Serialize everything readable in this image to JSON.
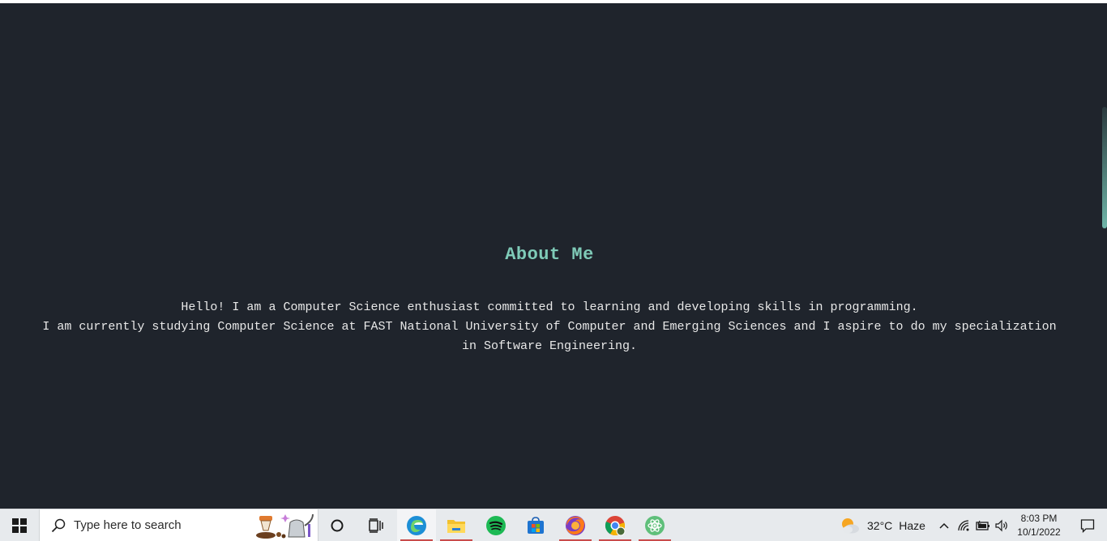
{
  "about": {
    "title": "About Me",
    "line1": "Hello! I am a Computer Science enthusiast committed to learning and developing skills in programming.",
    "line2": "I am currently studying Computer Science at FAST National University of Computer and Emerging Sciences and I aspire to do my specialization",
    "line3": "in Software Engineering."
  },
  "taskbar": {
    "search_placeholder": "Type here to search",
    "apps": [
      "windows-start-icon",
      "cortana-icon",
      "task-view-icon",
      "edge-icon",
      "file-explorer-icon",
      "spotify-icon",
      "microsoft-store-icon",
      "firefox-icon",
      "chrome-icon",
      "atom-icon"
    ],
    "weather": {
      "temperature": "32°C",
      "condition": "Haze",
      "icon": "partly-cloudy-icon"
    },
    "clock": {
      "time": "8:03 PM",
      "date": "10/1/2022"
    }
  },
  "colors": {
    "page_background": "#1f242c",
    "accent": "#7fcbb8",
    "body_text": "#e8e8e8",
    "taskbar_background": "#e7eaed"
  }
}
